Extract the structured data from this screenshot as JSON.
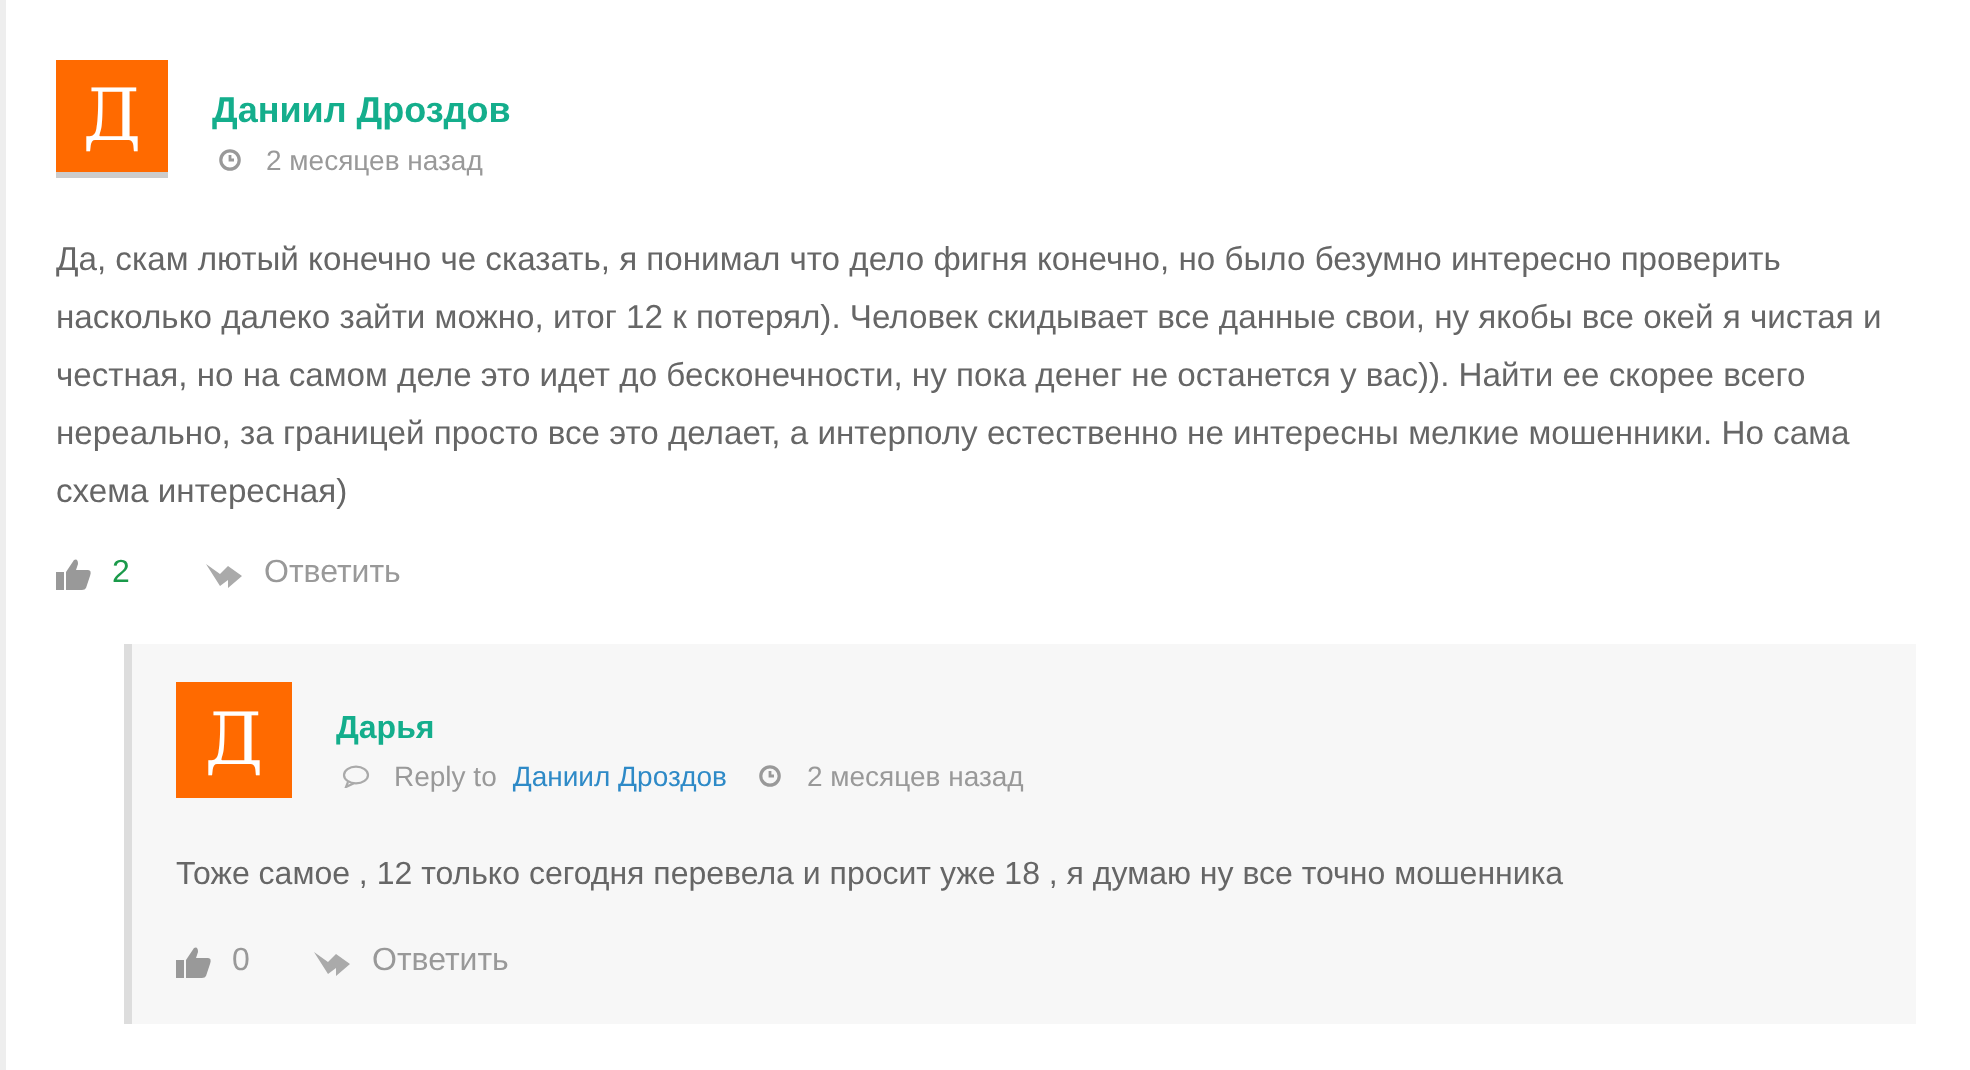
{
  "comments": [
    {
      "avatar_letter": "Д",
      "author": "Даниил Дроздов",
      "time": "2 месяцев назад",
      "text": "Да, скам лютый конечно че сказать, я понимал что дело фигня конечно, но было безумно интересно проверить насколько далеко зайти можно, итог 12 к потерял). Человек скидывает все данные свои, ну якобы все окей я чистая и честная, но на самом деле это идет до бесконечности, ну пока денег не останется у вас)). Найти ее скорее всего нереально, за границей просто все это делает, а интерполу естественно не интересны мелкие мошенники. Но сама схема интересная)",
      "votes": "2",
      "positive": true,
      "reply_label": "Ответить",
      "replies": [
        {
          "avatar_letter": "Д",
          "author": "Дарья",
          "reply_to_label": "Reply to",
          "reply_to": "Даниил Дроздов",
          "time": "2 месяцев назад",
          "text": "Тоже самое , 12 только сегодня перевела и просит уже 18 , я думаю ну все точно мошенника",
          "votes": "0",
          "positive": false,
          "reply_label": "Ответить"
        }
      ]
    }
  ]
}
